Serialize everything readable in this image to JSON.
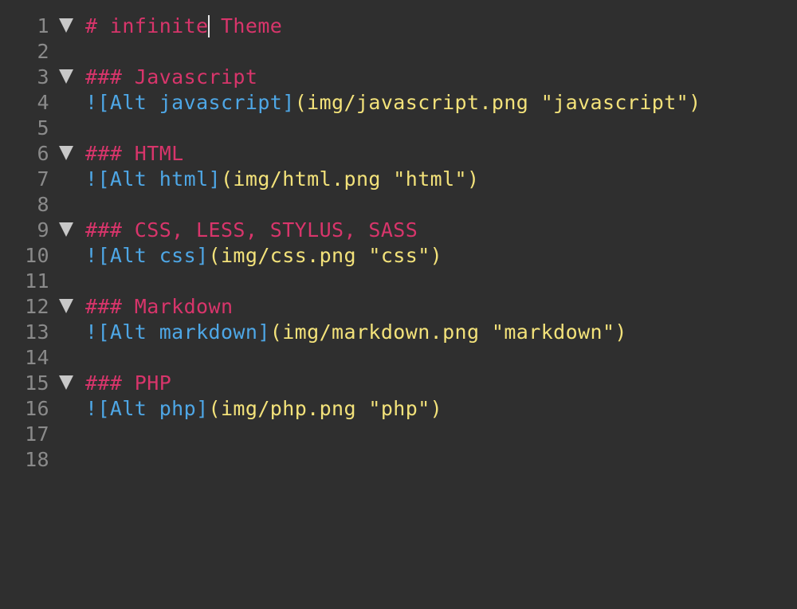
{
  "colors": {
    "background": "#2f2f2f",
    "gutter_number": "#8a8a8a",
    "heading": "#d8356b",
    "link_marker": "#4ea7e6",
    "alt_text": "#4ea7e6",
    "url_string": "#f3e27a",
    "fold_arrow": "#c8c8c8",
    "caret": "#e6e6e6"
  },
  "editor": {
    "fold_icon": "triangle-down-icon",
    "cursor": {
      "line": 1,
      "after_text": "# infinite"
    },
    "lines": [
      {
        "number": "1",
        "foldable": true,
        "kind": "heading",
        "heading": "# infinite",
        "heading_after_cursor": " Theme"
      },
      {
        "number": "2",
        "foldable": false,
        "kind": "empty"
      },
      {
        "number": "3",
        "foldable": true,
        "kind": "heading",
        "heading": "### Javascript"
      },
      {
        "number": "4",
        "foldable": false,
        "kind": "image",
        "open": "![",
        "alt": "Alt javascript",
        "close": "]",
        "url": "(img/javascript.png \"javascript\")"
      },
      {
        "number": "5",
        "foldable": false,
        "kind": "empty"
      },
      {
        "number": "6",
        "foldable": true,
        "kind": "heading",
        "heading": "### HTML"
      },
      {
        "number": "7",
        "foldable": false,
        "kind": "image",
        "open": "![",
        "alt": "Alt html",
        "close": "]",
        "url": "(img/html.png \"html\")"
      },
      {
        "number": "8",
        "foldable": false,
        "kind": "empty"
      },
      {
        "number": "9",
        "foldable": true,
        "kind": "heading",
        "heading": "### CSS, LESS, STYLUS, SASS"
      },
      {
        "number": "10",
        "foldable": false,
        "kind": "image",
        "open": "![",
        "alt": "Alt css",
        "close": "]",
        "url": "(img/css.png \"css\")"
      },
      {
        "number": "11",
        "foldable": false,
        "kind": "empty"
      },
      {
        "number": "12",
        "foldable": true,
        "kind": "heading",
        "heading": "### Markdown"
      },
      {
        "number": "13",
        "foldable": false,
        "kind": "image",
        "open": "![",
        "alt": "Alt markdown",
        "close": "]",
        "url": "(img/markdown.png \"markdown\")"
      },
      {
        "number": "14",
        "foldable": false,
        "kind": "empty"
      },
      {
        "number": "15",
        "foldable": true,
        "kind": "heading",
        "heading": "### PHP"
      },
      {
        "number": "16",
        "foldable": false,
        "kind": "image",
        "open": "![",
        "alt": "Alt php",
        "close": "]",
        "url": "(img/php.png \"php\")"
      },
      {
        "number": "17",
        "foldable": false,
        "kind": "empty"
      },
      {
        "number": "18",
        "foldable": false,
        "kind": "empty"
      }
    ]
  }
}
